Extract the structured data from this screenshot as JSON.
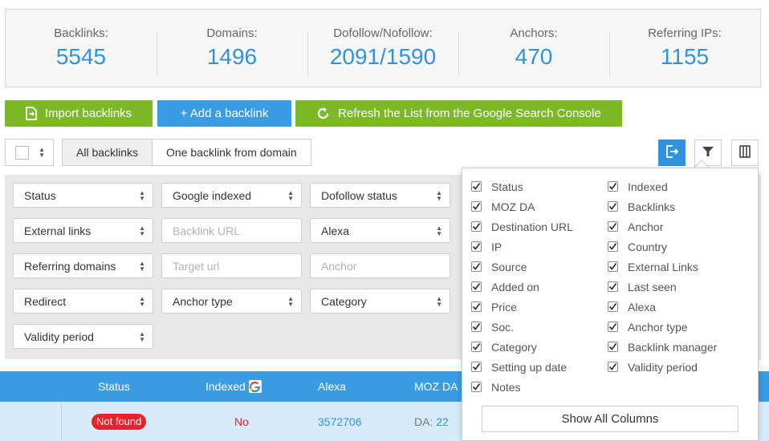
{
  "stats": [
    {
      "label": "Backlinks:",
      "value": "5545"
    },
    {
      "label": "Domains:",
      "value": "1496"
    },
    {
      "label": "Dofollow/Nofollow:",
      "value": "2091/1590"
    },
    {
      "label": "Anchors:",
      "value": "470"
    },
    {
      "label": "Referring IPs:",
      "value": "1155"
    }
  ],
  "actions": {
    "import": "Import backlinks",
    "add": "+ Add a backlink",
    "refresh": "Refresh the List from the Google Search Console"
  },
  "tabs": {
    "all": "All backlinks",
    "one": "One backlink from domain"
  },
  "filters": {
    "status": "Status",
    "google_indexed": "Google indexed",
    "dofollow_status": "Dofollow status",
    "external_links": "External links",
    "backlink_url_placeholder": "Backlink URL",
    "alexa": "Alexa",
    "referring_domains": "Referring domains",
    "target_url_placeholder": "Target url",
    "anchor_placeholder": "Anchor",
    "redirect": "Redirect",
    "anchor_type": "Anchor type",
    "category": "Category",
    "validity_period": "Validity period"
  },
  "table": {
    "headers": {
      "status": "Status",
      "indexed": "Indexed",
      "alexa": "Alexa",
      "moz_da": "MOZ DA"
    },
    "row": {
      "status": "Not found",
      "indexed": "No",
      "alexa": "3572706",
      "da_label": "DA:",
      "da_value": "22"
    }
  },
  "columns_menu": {
    "left": [
      "Status",
      "MOZ DA",
      "Destination URL",
      "IP",
      "Source",
      "Added on",
      "Price",
      "Soc.",
      "Category",
      "Setting up date",
      "Notes"
    ],
    "right": [
      "Indexed",
      "Backlinks",
      "Anchor",
      "Country",
      "External Links",
      "Last seen",
      "Alexa",
      "Anchor type",
      "Backlink manager",
      "Validity period"
    ],
    "show_all": "Show All Columns"
  },
  "colors": {
    "accent_blue": "#3a9de4",
    "accent_green": "#7cb827",
    "danger_red": "#e5232c"
  }
}
